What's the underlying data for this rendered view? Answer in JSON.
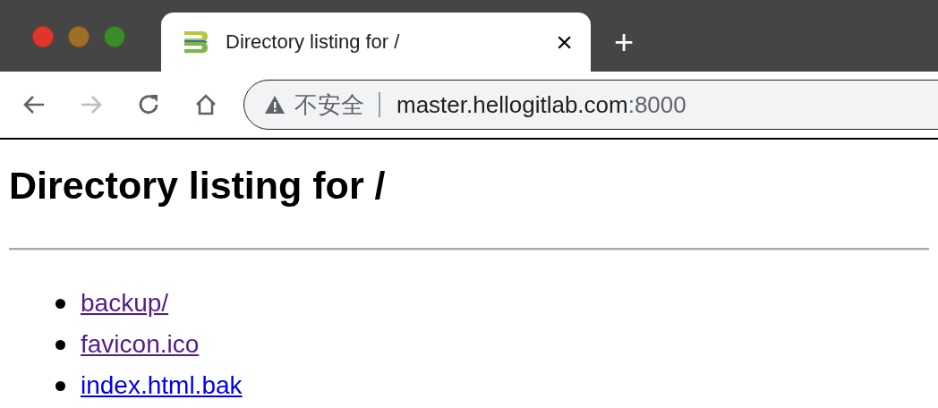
{
  "tab": {
    "title": "Directory listing for /",
    "close": "×",
    "new_tab": "+"
  },
  "address_bar": {
    "security": "不安全",
    "host": "master.hellogitlab.com",
    "port": ":8000"
  },
  "page": {
    "heading": "Directory listing for /",
    "links": [
      {
        "text": "backup/",
        "visited": true
      },
      {
        "text": "favicon.ico",
        "visited": true
      },
      {
        "text": "index.html.bak",
        "visited": false
      }
    ]
  }
}
